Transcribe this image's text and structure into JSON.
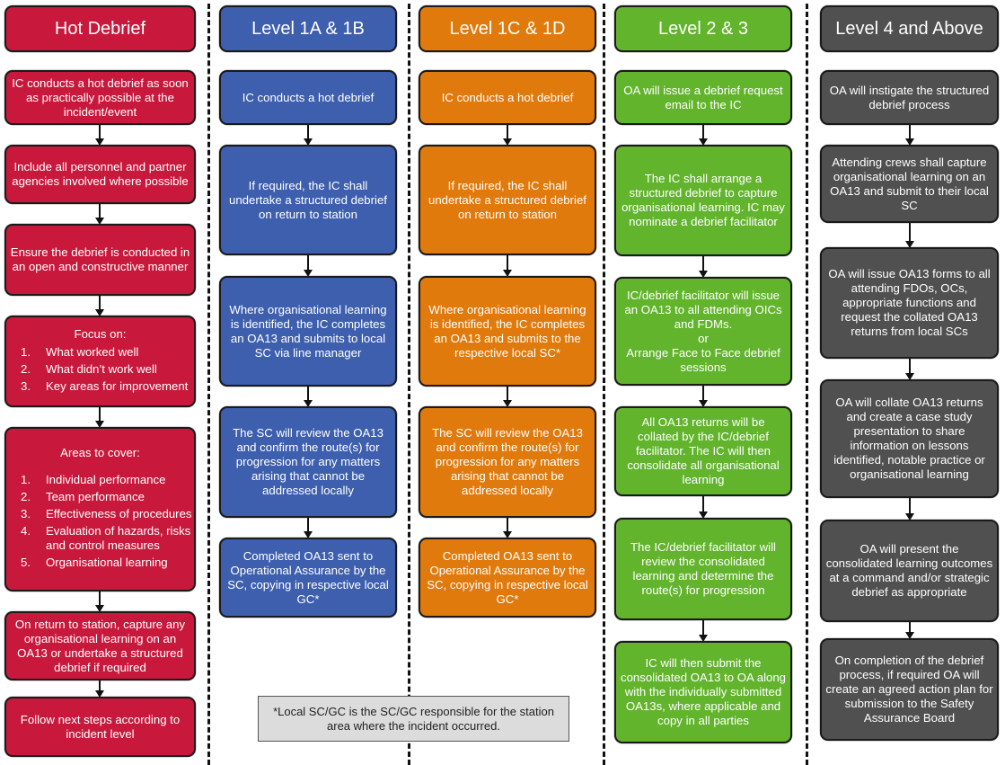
{
  "columns": [
    {
      "title": "Hot Debrief",
      "color": "#c8193c",
      "steps": [
        "IC conducts a hot debrief as soon as practically possible at the incident/event",
        "Include all personnel and partner agencies involved where possible",
        "Ensure the debrief is conducted in an open and constructive manner",
        {
          "heading": "Focus on:",
          "items": [
            "What worked well",
            "What didn’t work well",
            "Key areas for improvement"
          ]
        },
        {
          "heading": "Areas to cover:",
          "items": [
            "Individual performance",
            "Team performance",
            "Effectiveness of procedures",
            "Evaluation of hazards, risks and control measures",
            "Organisational learning"
          ]
        },
        "On return to station, capture any organisational learning on an OA13 or undertake a structured debrief if required",
        "Follow next steps according to incident level"
      ]
    },
    {
      "title": "Level 1A & 1B",
      "color": "#3d5fad",
      "steps": [
        "IC conducts a hot debrief",
        "If required, the IC shall undertake a structured debrief on return to station",
        "Where organisational learning is identified, the IC completes an OA13 and submits to local SC via line manager",
        "The SC will review the OA13 and confirm the route(s) for progression for any matters arising that cannot be addressed locally",
        "Completed OA13 sent to Operational Assurance by the SC, copying in respective local GC*"
      ]
    },
    {
      "title": "Level 1C & 1D",
      "color": "#e17a0c",
      "steps": [
        "IC conducts a hot debrief",
        "If required, the IC shall undertake a structured debrief on return to station",
        "Where organisational learning is identified, the IC completes an OA13 and submits to the respective local SC*",
        "The SC will review the OA13 and confirm the route(s) for progression for any matters arising that cannot be addressed locally",
        "Completed OA13 sent to Operational Assurance by the SC, copying in respective local GC*"
      ]
    },
    {
      "title": "Level 2 & 3",
      "color": "#62b42d",
      "steps": [
        "OA will issue a debrief request email to the IC",
        "The IC shall arrange a structured debrief to capture organisational learning. IC may nominate a debrief facilitator",
        {
          "lines": [
            "IC/debrief facilitator will issue an OA13 to all attending OICs and FDMs.",
            "or",
            "Arrange Face to Face debrief sessions"
          ]
        },
        "All OA13 returns will be collated by the IC/debrief facilitator. The IC will then consolidate all organisational learning",
        "The IC/debrief facilitator will review the consolidated learning and determine the route(s) for progression",
        "IC will then submit the consolidated OA13 to OA along with the individually submitted OA13s, where applicable and copy in all parties"
      ]
    },
    {
      "title": "Level 4 and Above",
      "color": "#505050",
      "steps": [
        "OA will instigate the structured debrief process",
        "Attending crews shall capture organisational learning on an OA13 and submit to their local SC",
        "OA will issue OA13 forms to all attending FDOs, OCs, appropriate functions and request the collated OA13 returns from local SCs",
        "OA will collate OA13 returns and create a case study presentation to share information on lessons identified, notable practice or organisational learning",
        "OA will present the consolidated learning outcomes at a command and/or strategic debrief as appropriate",
        "On completion of the debrief process, if required OA will create an agreed action plan for submission to the Safety Assurance Board"
      ]
    }
  ],
  "footnote": "*Local SC/GC is the SC/GC responsible for the station area where the incident occurred."
}
